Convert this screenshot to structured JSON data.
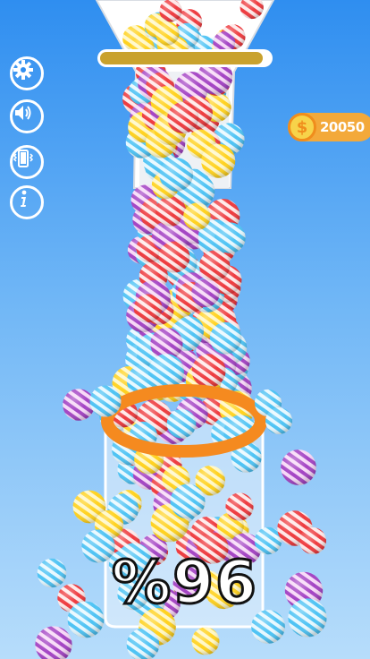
{
  "hud": {
    "coin_symbol": "$",
    "coin_count": "20050",
    "progress_text": "%96",
    "progress_value": 0.96
  },
  "buttons": {
    "settings_icon": "gear-icon",
    "sound_icon": "speaker-icon",
    "vibration_icon": "vibration-icon",
    "info_icon": "info-icon"
  },
  "colors": {
    "sky_top": "#2f8ef0",
    "sky_bottom": "#b7ddfb",
    "coin_pill": "#f3a93a",
    "ball_red": "#ee3b3f",
    "ball_yellow": "#ffd21f",
    "ball_blue": "#4ec3f4",
    "ball_purple": "#a444c4",
    "ring_orange": "#f58a1f"
  }
}
